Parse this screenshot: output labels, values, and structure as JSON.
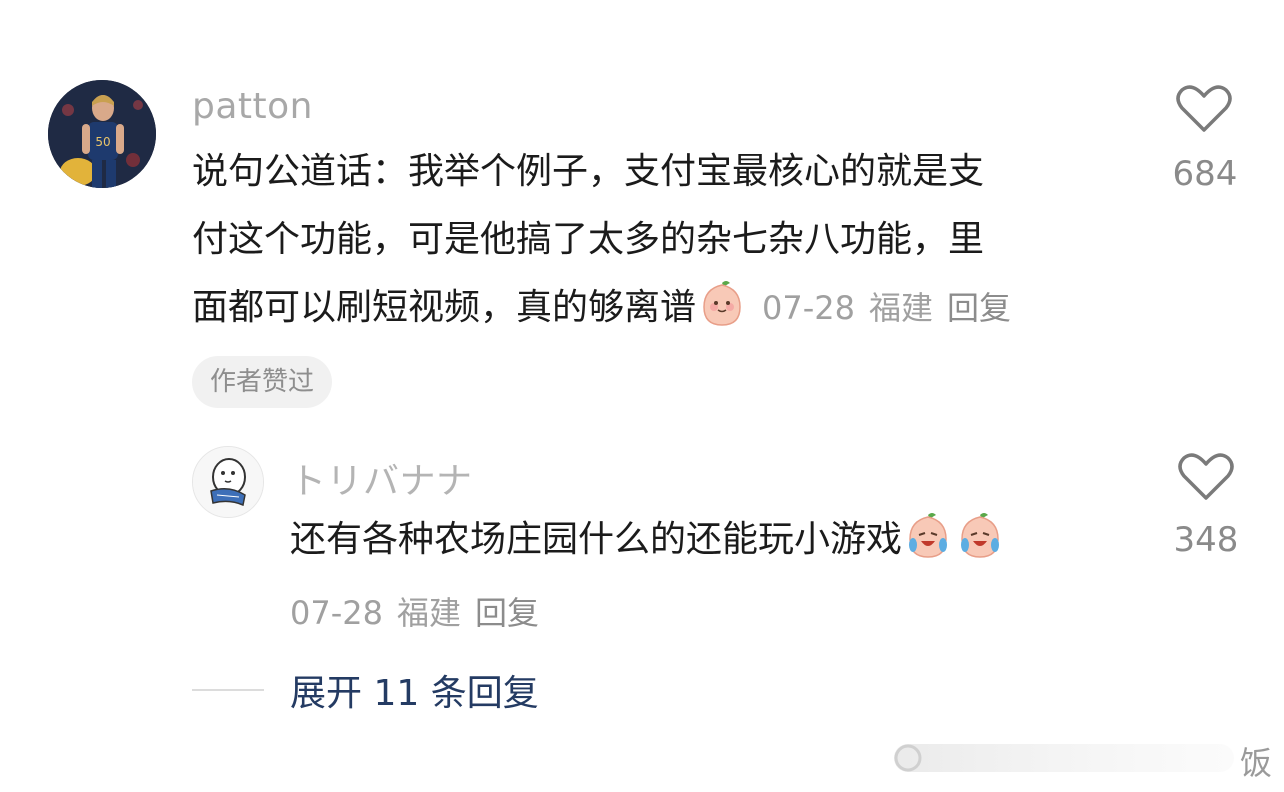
{
  "comment": {
    "username": "patton",
    "text_line1": "说句公道话：我举个例子，支付宝最核心的就是支",
    "text_line2": "付这个功能，可是他搞了太多的杂七杂八功能，里",
    "text_line3": "面都可以刷短视频，真的够离谱",
    "date": "07-28",
    "location": "福建",
    "reply_label": "回复",
    "like_count": "684",
    "badge": "作者赞过",
    "emoji": "smile-peach-emoji"
  },
  "reply": {
    "username": "トリバナナ",
    "text": "还有各种农场庄园什么的还能玩小游戏",
    "date": "07-28",
    "location": "福建",
    "reply_label": "回复",
    "like_count": "348",
    "emoji": "crying-laughing-peach-emoji"
  },
  "expand_label": "展开 11 条回复",
  "watermark": "饭",
  "colors": {
    "link": "#243b63",
    "meta": "#a0a0a0",
    "badge_bg": "#f1f1f1"
  }
}
